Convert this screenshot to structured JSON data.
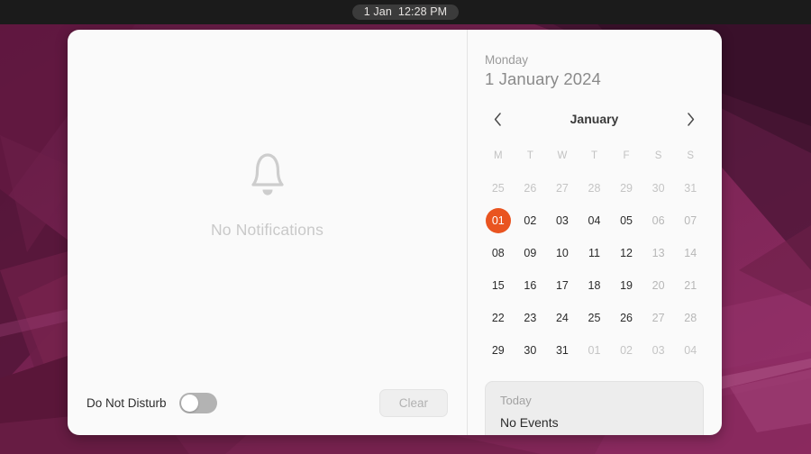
{
  "topbar": {
    "date": "1 Jan",
    "time": "12:28 PM",
    "clock_name": "clock"
  },
  "notifications": {
    "empty_label": "No Notifications",
    "bell_icon": "bell-icon",
    "do_not_disturb_label": "Do Not Disturb",
    "do_not_disturb_state": "off",
    "clear_label": "Clear",
    "clear_enabled": "false"
  },
  "calendar": {
    "weekday": "Monday",
    "full_date": "1 January 2024",
    "prev_icon": "chevron-left-icon",
    "next_icon": "chevron-right-icon",
    "month_label": "January",
    "weekday_headers": [
      "M",
      "T",
      "W",
      "T",
      "F",
      "S",
      "S"
    ],
    "selected_day": "01",
    "accent_color": "#e95420",
    "weeks": [
      [
        {
          "label": "25",
          "state": "dim"
        },
        {
          "label": "26",
          "state": "dim"
        },
        {
          "label": "27",
          "state": "dim"
        },
        {
          "label": "28",
          "state": "dim"
        },
        {
          "label": "29",
          "state": "dim"
        },
        {
          "label": "30",
          "state": "dim"
        },
        {
          "label": "31",
          "state": "dim"
        }
      ],
      [
        {
          "label": "01",
          "state": "selected"
        },
        {
          "label": "02",
          "state": "normal"
        },
        {
          "label": "03",
          "state": "normal"
        },
        {
          "label": "04",
          "state": "normal"
        },
        {
          "label": "05",
          "state": "normal"
        },
        {
          "label": "06",
          "state": "weekend"
        },
        {
          "label": "07",
          "state": "weekend"
        }
      ],
      [
        {
          "label": "08",
          "state": "normal"
        },
        {
          "label": "09",
          "state": "normal"
        },
        {
          "label": "10",
          "state": "normal"
        },
        {
          "label": "11",
          "state": "normal"
        },
        {
          "label": "12",
          "state": "normal"
        },
        {
          "label": "13",
          "state": "weekend"
        },
        {
          "label": "14",
          "state": "weekend"
        }
      ],
      [
        {
          "label": "15",
          "state": "normal"
        },
        {
          "label": "16",
          "state": "normal"
        },
        {
          "label": "17",
          "state": "normal"
        },
        {
          "label": "18",
          "state": "normal"
        },
        {
          "label": "19",
          "state": "normal"
        },
        {
          "label": "20",
          "state": "weekend"
        },
        {
          "label": "21",
          "state": "weekend"
        }
      ],
      [
        {
          "label": "22",
          "state": "normal"
        },
        {
          "label": "23",
          "state": "normal"
        },
        {
          "label": "24",
          "state": "normal"
        },
        {
          "label": "25",
          "state": "normal"
        },
        {
          "label": "26",
          "state": "normal"
        },
        {
          "label": "27",
          "state": "weekend"
        },
        {
          "label": "28",
          "state": "weekend"
        }
      ],
      [
        {
          "label": "29",
          "state": "normal"
        },
        {
          "label": "30",
          "state": "normal"
        },
        {
          "label": "31",
          "state": "normal"
        },
        {
          "label": "01",
          "state": "dim"
        },
        {
          "label": "02",
          "state": "dim"
        },
        {
          "label": "03",
          "state": "dim"
        },
        {
          "label": "04",
          "state": "dim"
        }
      ]
    ]
  },
  "events": {
    "title": "Today",
    "body": "No Events"
  }
}
